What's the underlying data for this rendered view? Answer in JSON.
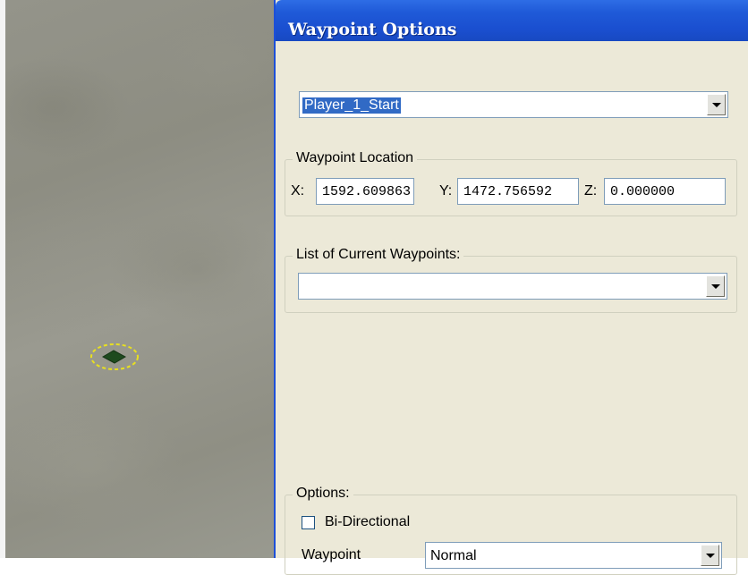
{
  "dialog": {
    "title": "Waypoint Options",
    "waypoint_select": {
      "value": "Player_1_Start"
    },
    "location_group": {
      "label": "Waypoint Location",
      "x_label": "X:",
      "x_value": "1592.609863",
      "y_label": "Y:",
      "y_value": "1472.756592",
      "z_label": "Z:",
      "z_value": "0.000000"
    },
    "list_group": {
      "label": "List of Current Waypoints:",
      "value": ""
    },
    "options_group": {
      "label": "Options:",
      "bidirectional_label": "Bi-Directional",
      "bidirectional_checked": false,
      "waypoint_type_label": "Waypoint",
      "waypoint_type_value": "Normal"
    }
  },
  "colors": {
    "title_bar": "#1f5ad8",
    "dialog_bg": "#ece9d8",
    "selection": "#316ac5",
    "marker_ring": "#e8e020",
    "marker_fill": "#1e4a1e"
  },
  "icons": [
    "dropdown-arrow-icon",
    "waypoint-marker-icon"
  ]
}
